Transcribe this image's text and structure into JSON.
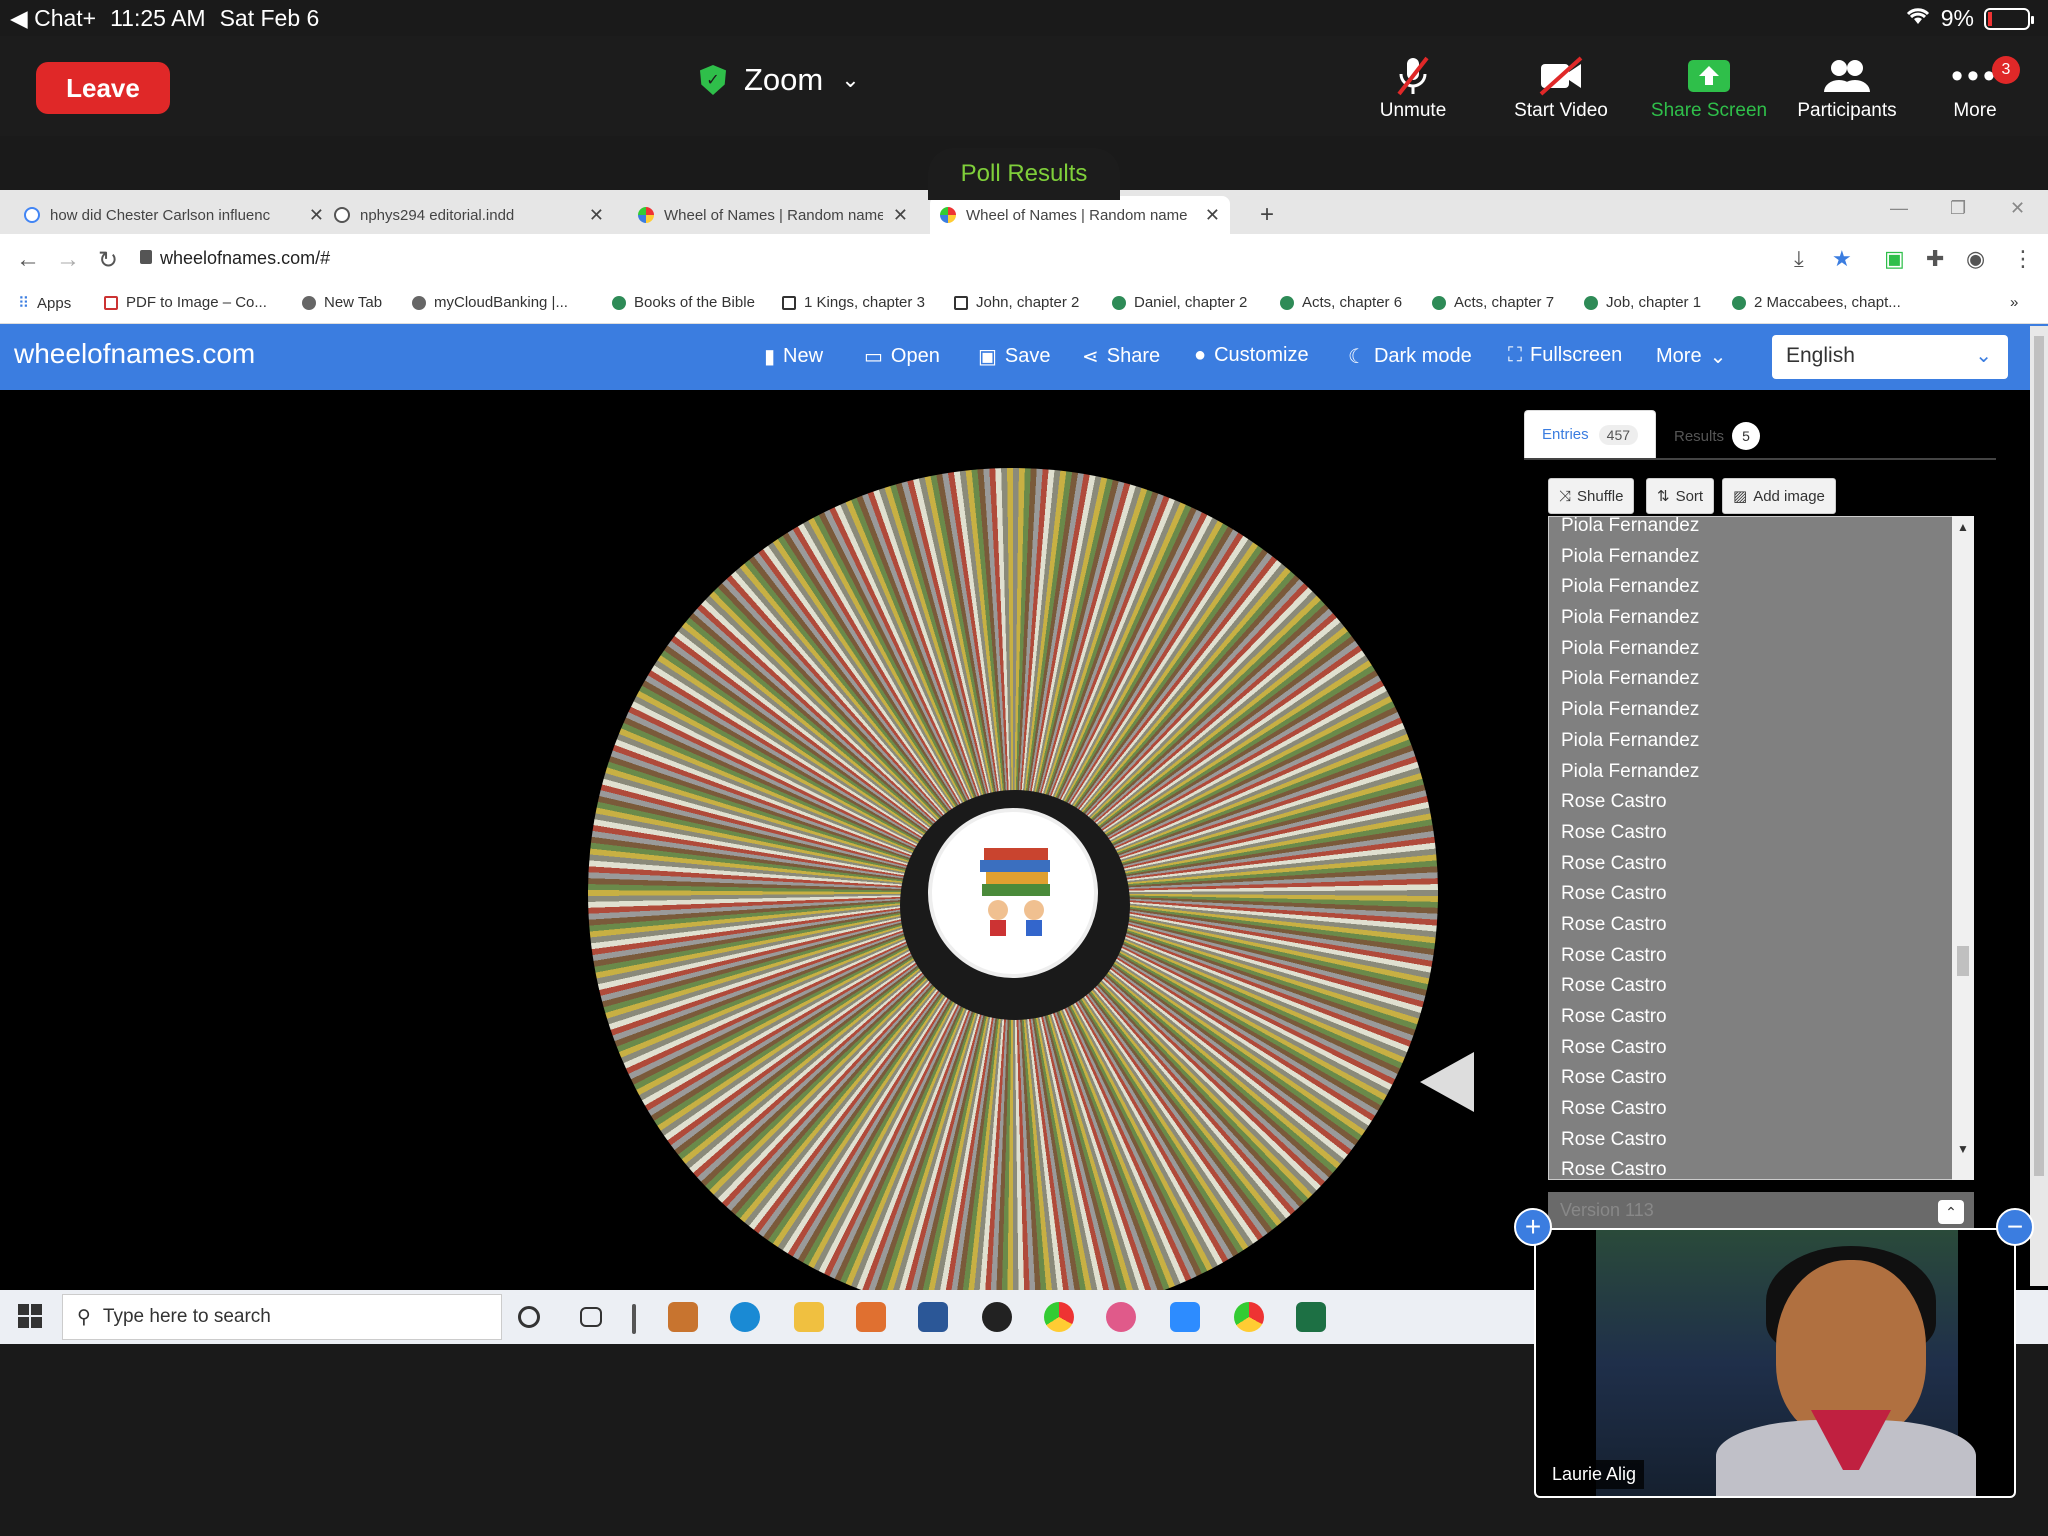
{
  "status_bar": {
    "back_app": "◀ Chat+",
    "time": "11:25 AM",
    "date": "Sat Feb 6",
    "battery": "9%"
  },
  "zoom": {
    "leave_label": "Leave",
    "title": "Zoom",
    "controls": [
      {
        "label": "Unmute",
        "icon": "microphone-muted-icon"
      },
      {
        "label": "Start Video",
        "icon": "video-off-icon"
      },
      {
        "label": "Share Screen",
        "icon": "share-screen-icon"
      },
      {
        "label": "Participants",
        "icon": "participants-icon"
      },
      {
        "label": "More",
        "icon": "more-icon"
      }
    ],
    "more_badge": "3",
    "poll_label": "Poll Results"
  },
  "browser": {
    "tabs": [
      {
        "title": "how did Chester Carlson influenc"
      },
      {
        "title": "nphys294 editorial.indd"
      },
      {
        "title": "Wheel of Names | Random name"
      },
      {
        "title": "Wheel of Names | Random name"
      }
    ],
    "url": "wheelofnames.com/#",
    "bookmarks": [
      "Apps",
      "PDF to Image – Co...",
      "New Tab",
      "myCloudBanking |...",
      "Books of the Bible",
      "1 Kings, chapter 3",
      "John, chapter 2",
      "Daniel, chapter 2",
      "Acts, chapter 6",
      "Acts, chapter 7",
      "Job, chapter 1",
      "2 Maccabees, chapt..."
    ]
  },
  "site": {
    "brand": "wheelofnames.com",
    "menu": [
      "New",
      "Open",
      "Save",
      "Share",
      "Customize",
      "Dark mode",
      "Fullscreen",
      "More"
    ],
    "language": "English",
    "entries_tab": "Entries",
    "entries_count": "457",
    "results_tab": "Results",
    "results_count": "5",
    "buttons": [
      "Shuffle",
      "Sort",
      "Add image"
    ],
    "entries": [
      "Piola Fernandez",
      "Piola Fernandez",
      "Piola Fernandez",
      "Piola Fernandez",
      "Piola Fernandez",
      "Piola Fernandez",
      "Piola Fernandez",
      "Piola Fernandez",
      "Piola Fernandez",
      "Rose Castro",
      "Rose Castro",
      "Rose Castro",
      "Rose Castro",
      "Rose Castro",
      "Rose Castro",
      "Rose Castro",
      "Rose Castro",
      "Rose Castro",
      "Rose Castro",
      "Rose Castro",
      "Rose Castro",
      "Rose Castro"
    ],
    "version": "Version 113"
  },
  "taskbar": {
    "search_placeholder": "Type here to search"
  },
  "video": {
    "participant_name": "Laurie Alig"
  },
  "colors": {
    "zoom_bg": "#1c1c1c",
    "leave_red": "#e02828",
    "site_blue": "#3b7de0",
    "share_green": "#2fbf4a",
    "poll_green": "#7fcf3a"
  }
}
